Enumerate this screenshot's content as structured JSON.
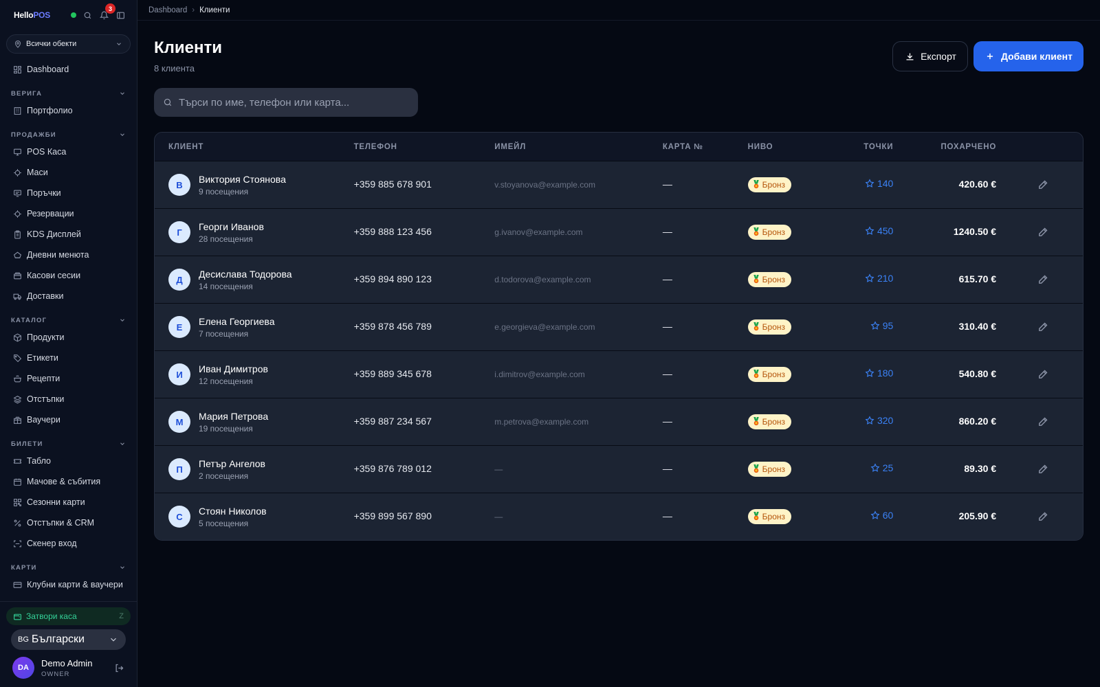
{
  "brand": {
    "name_part1": "Hello",
    "name_part2": "POS",
    "notifications_count": "3"
  },
  "store_selector": {
    "label": "Всички обекти"
  },
  "nav": {
    "dashboard": "Dashboard",
    "sections": [
      {
        "title": "ВЕРИГА",
        "items": [
          {
            "label": "Портфолио",
            "icon": "building-icon"
          }
        ]
      },
      {
        "title": "ПРОДАЖБИ",
        "items": [
          {
            "label": "POS Каса",
            "icon": "monitor-icon"
          },
          {
            "label": "Маси",
            "icon": "table-icon"
          },
          {
            "label": "Поръчки",
            "icon": "receipt-icon"
          },
          {
            "label": "Резервации",
            "icon": "calendar-check-icon"
          },
          {
            "label": "KDS Дисплей",
            "icon": "clipboard-icon"
          },
          {
            "label": "Дневни менюта",
            "icon": "chef-hat-icon"
          },
          {
            "label": "Касови сесии",
            "icon": "wallet-icon"
          },
          {
            "label": "Доставки",
            "icon": "truck-icon"
          }
        ]
      },
      {
        "title": "КАТАЛОГ",
        "items": [
          {
            "label": "Продукти",
            "icon": "box-icon"
          },
          {
            "label": "Етикети",
            "icon": "tag-icon"
          },
          {
            "label": "Рецепти",
            "icon": "pot-icon"
          },
          {
            "label": "Отстъпки",
            "icon": "layers-icon"
          },
          {
            "label": "Ваучери",
            "icon": "gift-icon"
          }
        ]
      },
      {
        "title": "БИЛЕТИ",
        "items": [
          {
            "label": "Табло",
            "icon": "ticket-icon"
          },
          {
            "label": "Мачове & събития",
            "icon": "calendar-icon"
          },
          {
            "label": "Сезонни карти",
            "icon": "qr-icon"
          },
          {
            "label": "Отстъпки & CRM",
            "icon": "percent-icon"
          },
          {
            "label": "Скенер вход",
            "icon": "scan-icon"
          }
        ]
      },
      {
        "title": "КАРТИ",
        "items": [
          {
            "label": "Клубни карти & ваучери",
            "icon": "credit-card-icon"
          }
        ]
      }
    ]
  },
  "close_cash": {
    "label": "Затвори каса",
    "shortcut": "Z"
  },
  "language": {
    "code": "BG",
    "label": "Български"
  },
  "user": {
    "initials": "DA",
    "name": "Demo Admin",
    "role": "OWNER"
  },
  "breadcrumb": {
    "root": "Dashboard",
    "current": "Клиенти"
  },
  "page": {
    "title": "Клиенти",
    "subtitle": "8 клиента"
  },
  "actions": {
    "export": "Експорт",
    "add": "Добави клиент"
  },
  "search": {
    "placeholder": "Търси по име, телефон или карта...",
    "value": ""
  },
  "table": {
    "columns": [
      "КЛИЕНТ",
      "ТЕЛЕФОН",
      "ИМЕЙЛ",
      "КАРТА №",
      "НИВО",
      "ТОЧКИ",
      "ПОХАРЧЕНО"
    ],
    "rows": [
      {
        "initial": "В",
        "name": "Виктория Стоянова",
        "visits": "9 посещения",
        "phone": "+359 885 678 901",
        "email": "v.stoyanova@example.com",
        "card": "—",
        "level": "Бронз",
        "points": "140",
        "spent": "420.60 €"
      },
      {
        "initial": "Г",
        "name": "Георги Иванов",
        "visits": "28 посещения",
        "phone": "+359 888 123 456",
        "email": "g.ivanov@example.com",
        "card": "—",
        "level": "Бронз",
        "points": "450",
        "spent": "1240.50 €"
      },
      {
        "initial": "Д",
        "name": "Десислава Тодорова",
        "visits": "14 посещения",
        "phone": "+359 894 890 123",
        "email": "d.todorova@example.com",
        "card": "—",
        "level": "Бронз",
        "points": "210",
        "spent": "615.70 €"
      },
      {
        "initial": "Е",
        "name": "Елена Георгиева",
        "visits": "7 посещения",
        "phone": "+359 878 456 789",
        "email": "e.georgieva@example.com",
        "card": "—",
        "level": "Бронз",
        "points": "95",
        "spent": "310.40 €"
      },
      {
        "initial": "И",
        "name": "Иван Димитров",
        "visits": "12 посещения",
        "phone": "+359 889 345 678",
        "email": "i.dimitrov@example.com",
        "card": "—",
        "level": "Бронз",
        "points": "180",
        "spent": "540.80 €"
      },
      {
        "initial": "М",
        "name": "Мария Петрова",
        "visits": "19 посещения",
        "phone": "+359 887 234 567",
        "email": "m.petrova@example.com",
        "card": "—",
        "level": "Бронз",
        "points": "320",
        "spent": "860.20 €"
      },
      {
        "initial": "П",
        "name": "Петър Ангелов",
        "visits": "2 посещения",
        "phone": "+359 876 789 012",
        "email": "—",
        "card": "—",
        "level": "Бронз",
        "points": "25",
        "spent": "89.30 €"
      },
      {
        "initial": "С",
        "name": "Стоян Николов",
        "visits": "5 посещения",
        "phone": "+359 899 567 890",
        "email": "—",
        "card": "—",
        "level": "Бронз",
        "points": "60",
        "spent": "205.90 €"
      }
    ]
  },
  "colors": {
    "accent": "#2563eb",
    "points": "#3b82f6",
    "bronze_bg": "#fef3c7",
    "bronze_text": "#b45309",
    "success": "#34d399"
  }
}
